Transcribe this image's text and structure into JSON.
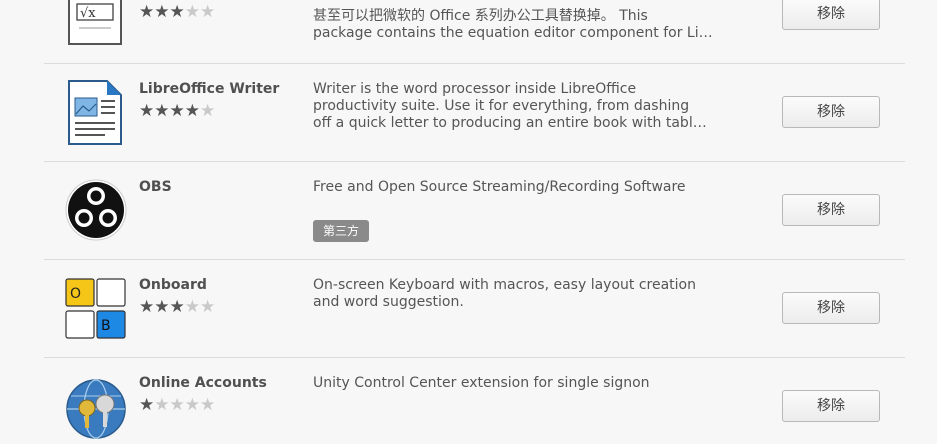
{
  "apps": [
    {
      "id": "math",
      "name": "",
      "icon": "libreoffice-math-icon",
      "rating": 3,
      "description": [
        "甚至可以把微软的 Office 系列办公工具替换掉。 This",
        "package contains the equation editor component for Li…"
      ],
      "badge": "",
      "button": "移除"
    },
    {
      "id": "writer",
      "name": "LibreOffice Writer",
      "icon": "libreoffice-writer-icon",
      "rating": 4,
      "description": [
        "Writer is the word processor inside LibreOffice",
        "productivity suite. Use it for everything, from dashing",
        "off a quick letter to producing an entire book with tabl…"
      ],
      "badge": "",
      "button": "移除"
    },
    {
      "id": "obs",
      "name": "OBS",
      "icon": "obs-icon",
      "rating": 0,
      "description": [
        "Free and Open Source Streaming/Recording Software"
      ],
      "badge": "第三方",
      "button": "移除"
    },
    {
      "id": "onboard",
      "name": "Onboard",
      "icon": "onboard-keyboard-icon",
      "icon_keys": [
        "O",
        "B"
      ],
      "rating": 3,
      "description": [
        "On-screen Keyboard with macros, easy layout creation",
        "and word suggestion."
      ],
      "badge": "",
      "button": "移除"
    },
    {
      "id": "accounts",
      "name": "Online Accounts",
      "icon": "online-accounts-icon",
      "rating": 1,
      "description": [
        "Unity Control Center extension for single signon"
      ],
      "badge": "",
      "button": "移除"
    }
  ],
  "colors": {
    "onboard_key_yellow": "#f5c518",
    "onboard_key_blue": "#1e88e5",
    "badge_bg": "#8a8a8a"
  }
}
